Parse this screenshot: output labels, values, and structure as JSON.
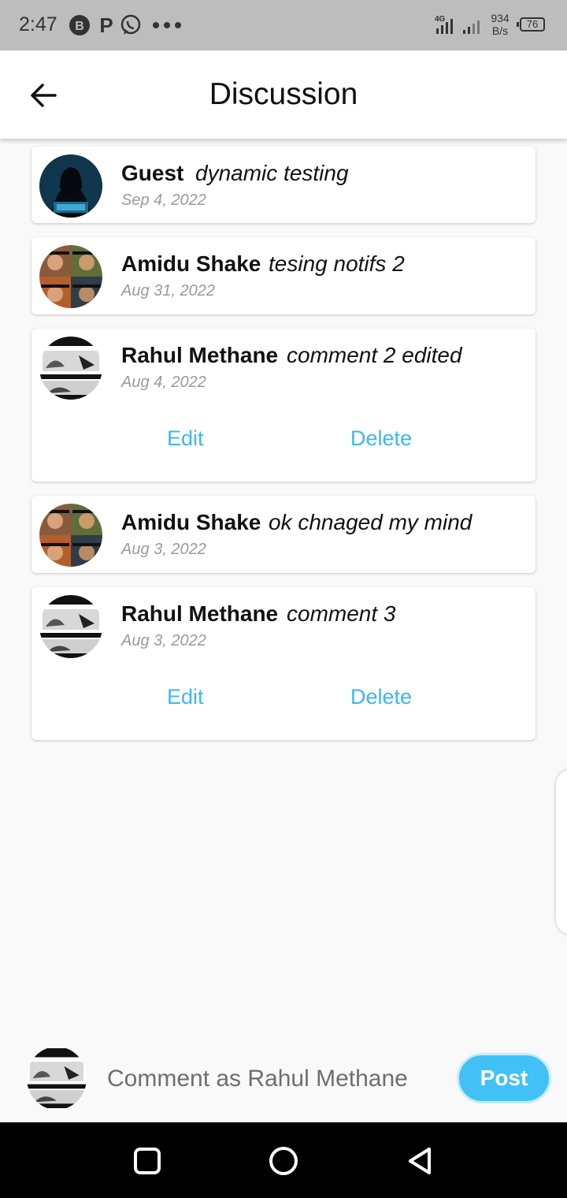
{
  "status_bar": {
    "time": "2:47",
    "notification_icons": [
      "b-circle-icon",
      "p-icon",
      "whatsapp-icon",
      "more-dots-icon"
    ],
    "network_type": "4G",
    "net_speed_value": "934",
    "net_speed_unit": "B/s",
    "battery_level": "76"
  },
  "app_bar": {
    "title": "Discussion",
    "back_icon": "arrow-left-icon"
  },
  "comments": [
    {
      "author": "Guest",
      "text": "dynamic testing",
      "date": "Sep 4, 2022",
      "avatar": "hacker-avatar"
    },
    {
      "author": "Amidu Shake",
      "text": "tesing notifs 2",
      "date": "Aug 31, 2022",
      "avatar": "collage-avatar"
    },
    {
      "author": "Rahul Methane",
      "text": "comment 2 edited",
      "date": "Aug 4, 2022",
      "avatar": "comic-avatar",
      "edit_label": "Edit",
      "delete_label": "Delete"
    },
    {
      "author": "Amidu Shake",
      "text": "ok chnaged my mind",
      "date": "Aug 3, 2022",
      "avatar": "collage-avatar"
    },
    {
      "author": "Rahul Methane",
      "text": "comment 3",
      "date": "Aug 3, 2022",
      "avatar": "comic-avatar",
      "edit_label": "Edit",
      "delete_label": "Delete"
    }
  ],
  "composer": {
    "placeholder": "Comment as Rahul Methane",
    "post_label": "Post"
  },
  "colors": {
    "accent": "#42c1f7",
    "action_text": "#3bb8ee",
    "date_text": "#9a9a9a",
    "background": "#f9f9f9"
  },
  "nav_bar": {
    "icons": [
      "recents-square-icon",
      "home-circle-icon",
      "back-triangle-icon"
    ]
  }
}
